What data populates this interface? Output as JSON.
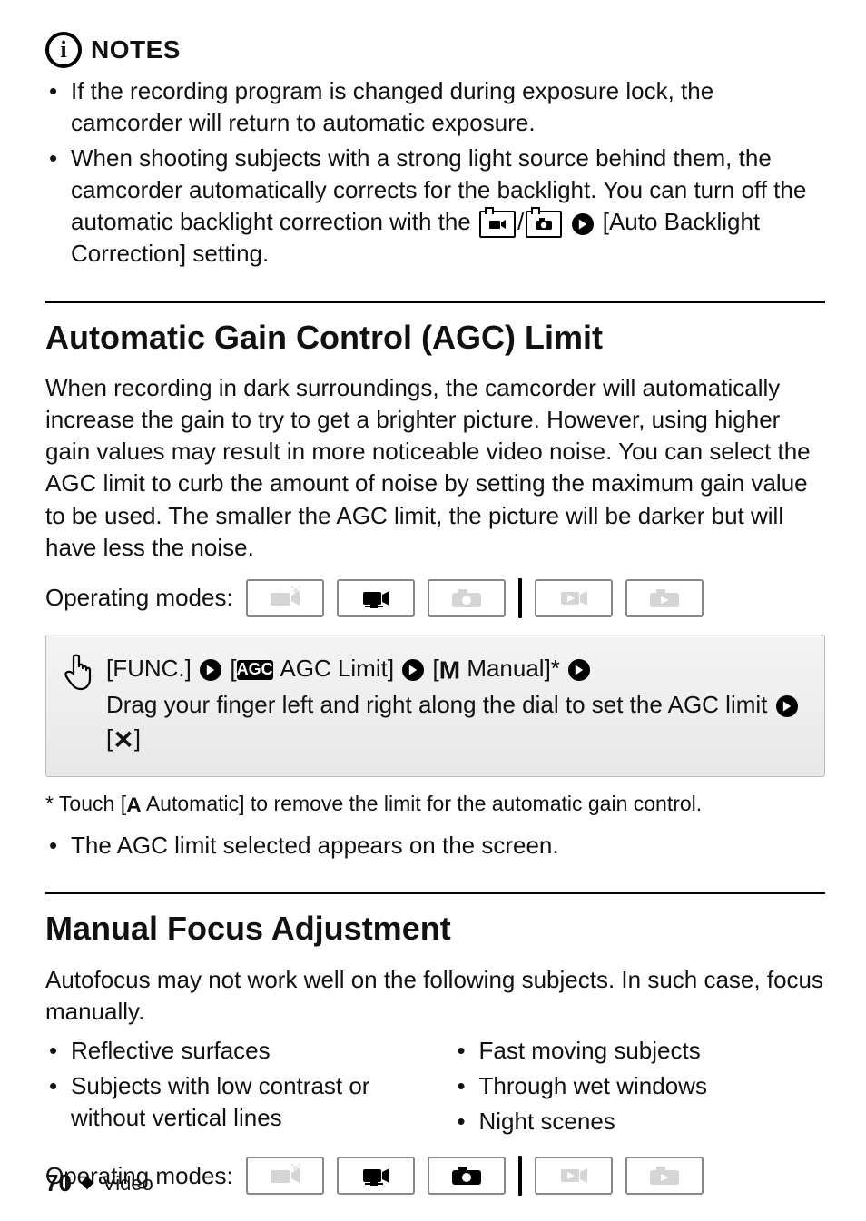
{
  "notes": {
    "label": "NOTES",
    "items": [
      "If the recording program is changed during exposure lock, the camcorder will return to automatic exposure.",
      "When shooting subjects with a strong light source behind them, the camcorder automatically corrects for the backlight. You can turn off the automatic backlight correction with the",
      "[Auto Backlight Correction] setting."
    ]
  },
  "agc": {
    "title": "Automatic Gain Control (AGC) Limit",
    "body": "When recording in dark surroundings, the camcorder will automatically increase the gain to try to get a brighter picture. However, using higher gain values may result in more noticeable video noise. You can select the AGC limit to curb the amount of noise by setting the maximum gain value to be used. The smaller the AGC limit, the picture will be darker but will have less the noise.",
    "modes_label": "Operating modes:",
    "instruction": {
      "func": "[FUNC.]",
      "agc_badge": "AGC",
      "agc_label": "AGC Limit]",
      "manual": "Manual]*",
      "drag": "Drag your finger left and right along the dial to set the AGC limit",
      "close": "]"
    },
    "footnote_pre": "* Touch [",
    "footnote_post": " Automatic] to remove the limit for the automatic gain control.",
    "bullet_after": "The AGC limit selected appears on the screen."
  },
  "mfocus": {
    "title": "Manual Focus Adjustment",
    "body": "Autofocus may not work well on the following subjects. In such case, focus manually.",
    "left_items": [
      "Reflective surfaces",
      "Subjects with low contrast or without vertical lines"
    ],
    "right_items": [
      "Fast moving subjects",
      "Through wet windows",
      "Night scenes"
    ],
    "modes_label": "Operating modes:"
  },
  "footer": {
    "page": "70",
    "section": "Video"
  }
}
